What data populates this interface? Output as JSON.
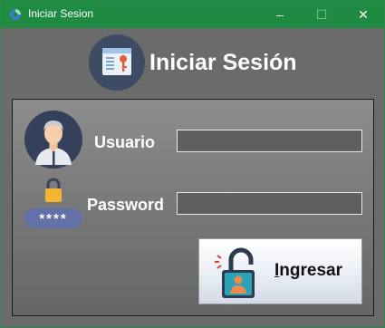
{
  "window": {
    "title": "Iniciar Sesion",
    "controls": {
      "minimize": "–",
      "maximize": "☐",
      "close": "✕"
    }
  },
  "header": {
    "title": "Iniciar Sesión",
    "logo_icon": "id-card-key-icon"
  },
  "form": {
    "avatar_icon": "user-avatar-icon",
    "username_label": "Usuario",
    "username_value": "",
    "password_label": "Password",
    "password_value": "",
    "password_icon": "padlock-icon",
    "password_mask": "****"
  },
  "login_button": {
    "accel": "I",
    "rest": "ngresar",
    "icon": "unlocked-padlock-user-icon"
  },
  "colors": {
    "titlebar": "#1f8a42",
    "background": "#6b6b6b",
    "password_pill": "#6470a8"
  }
}
